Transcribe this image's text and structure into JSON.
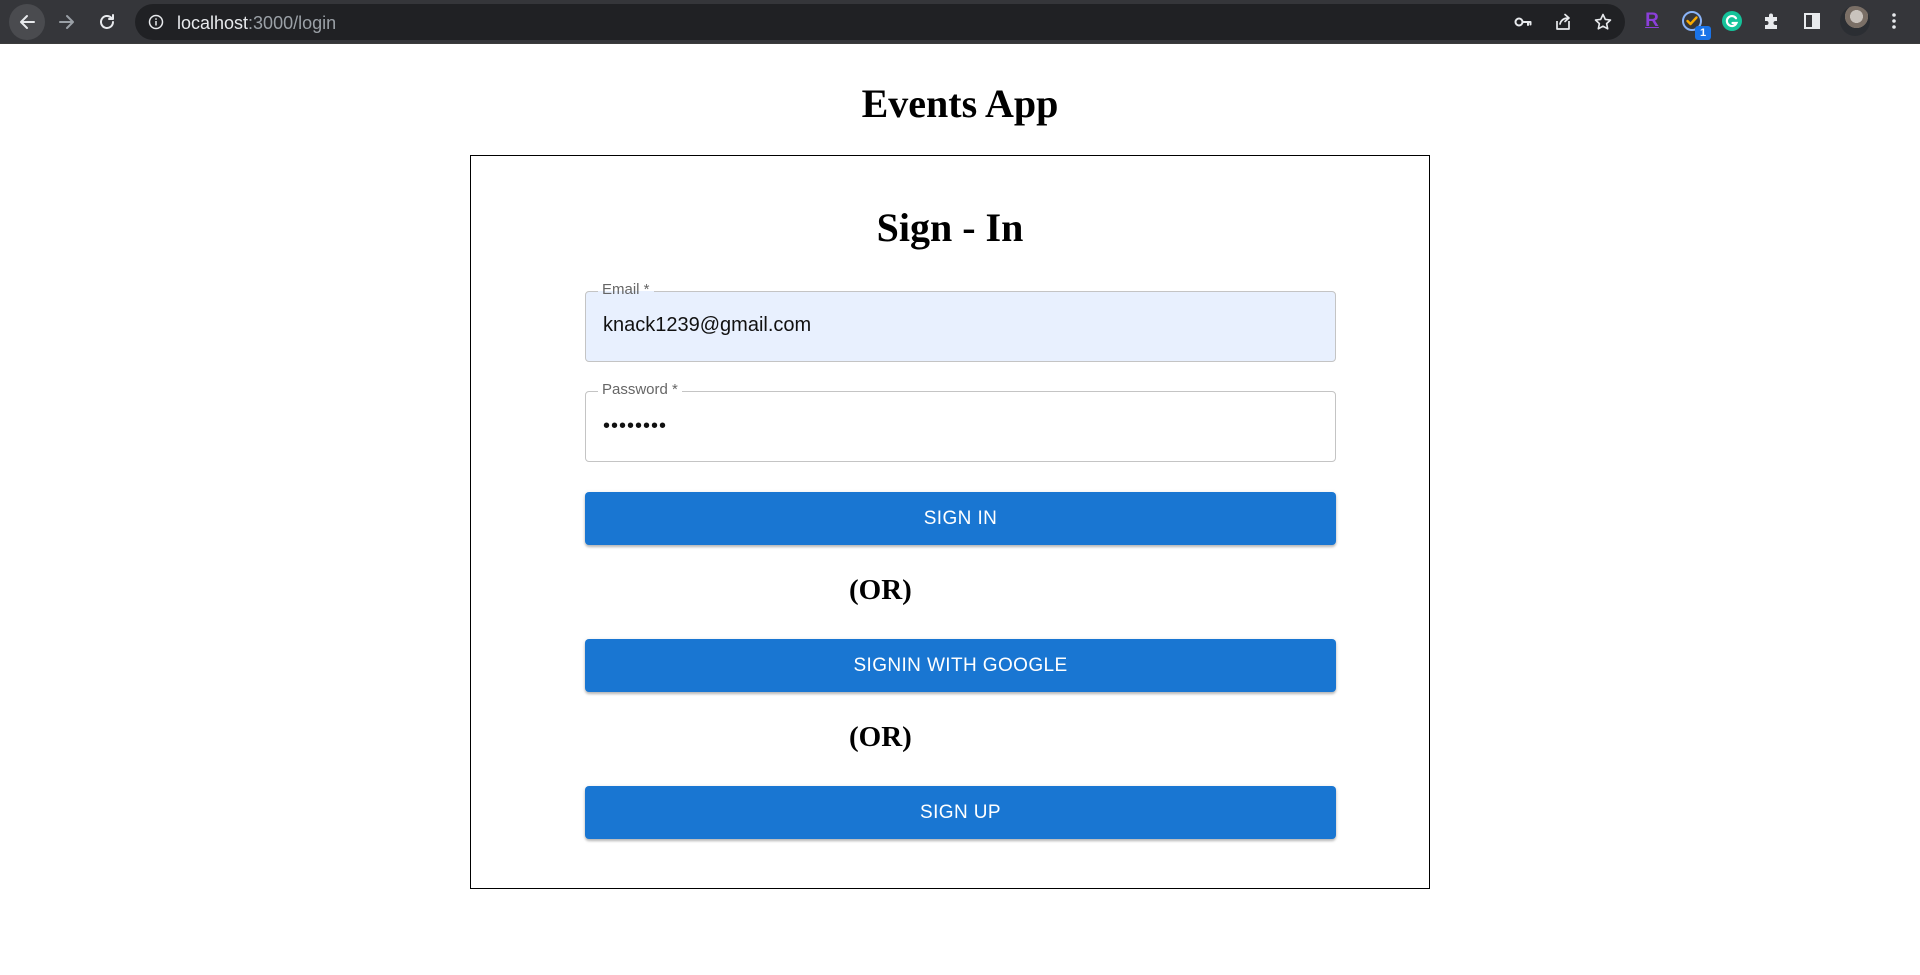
{
  "browser": {
    "url_host": "localhost",
    "url_path": ":3000/login",
    "extensions": {
      "r_label": "R",
      "check_badge": "1"
    }
  },
  "page": {
    "app_title": "Events App",
    "form_title": "Sign - In",
    "email": {
      "label": "Email *",
      "value": "knack1239@gmail.com"
    },
    "password": {
      "label": "Password *",
      "value": "••••••••"
    },
    "signin_button": "SIGN IN",
    "or_text_1": "(OR)",
    "google_button": "SIGNIN WITH GOOGLE",
    "or_text_2": "(OR)",
    "signup_button": "SIGN UP"
  },
  "colors": {
    "primary_button": "#1976d2",
    "autofill_background": "#e8f0fe",
    "chrome_bar": "#35363a",
    "omnibox": "#202124"
  }
}
